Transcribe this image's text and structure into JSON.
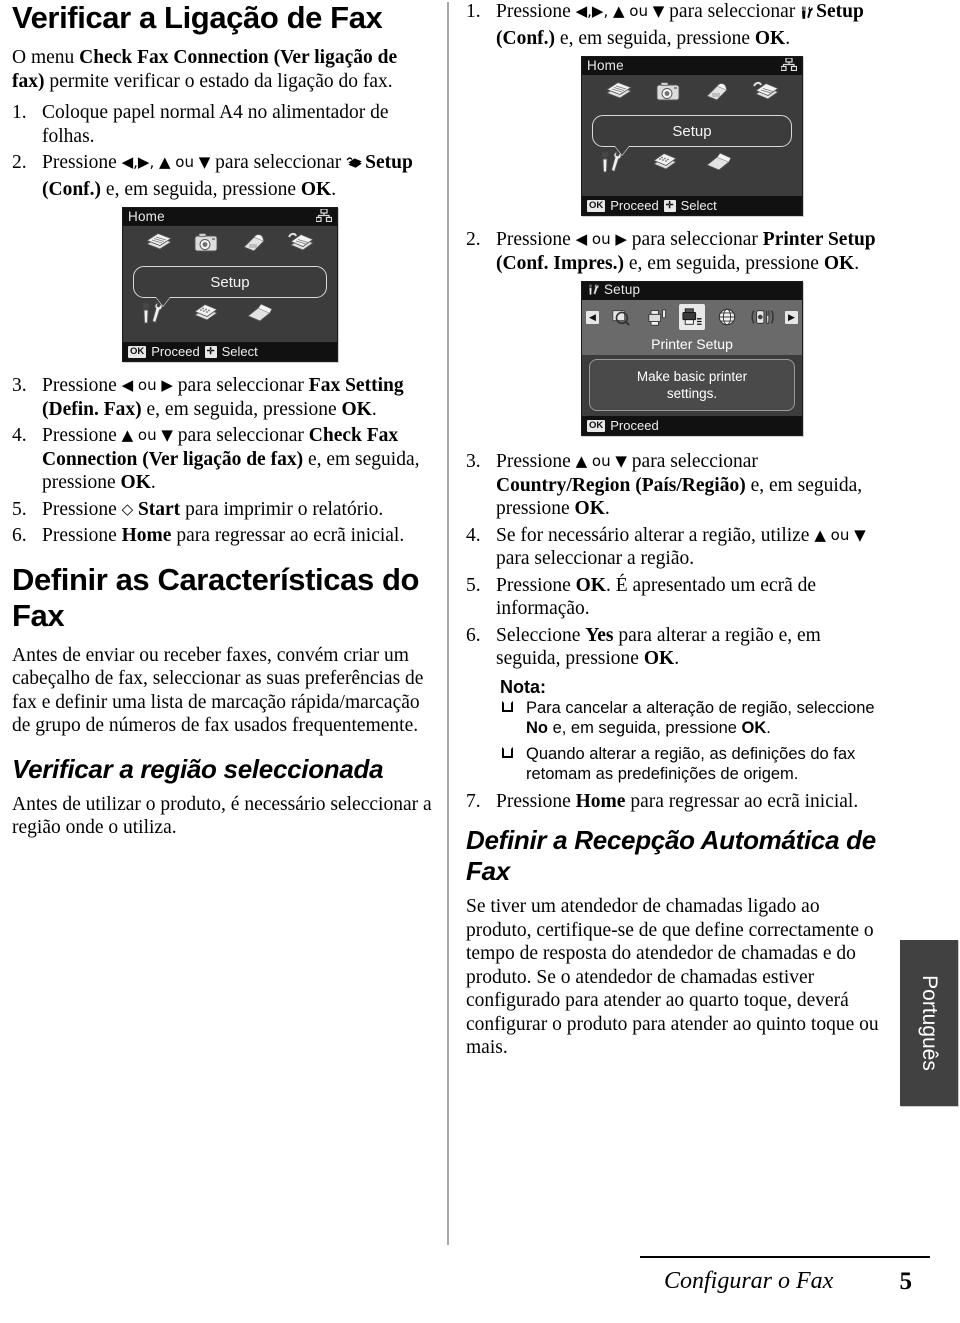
{
  "left_column": {
    "heading": "Verificar a Ligação de Fax",
    "intro_parts": {
      "a": "O menu ",
      "b": "Check Fax Connection (Ver ligação de fax)",
      "c": " permite verificar o estado da ligação do fax."
    },
    "steps": [
      {
        "num": "1.",
        "parts": [
          {
            "t": "Coloque papel normal A4 no alimentador de folhas.",
            "b": false
          }
        ]
      },
      {
        "num": "2.",
        "parts": [
          {
            "t": "Pressione ",
            "b": false
          },
          {
            "t": "◀,▶, ▲ ou ▼",
            "b": false,
            "glyph": true
          },
          {
            "t": " para seleccionar ",
            "b": false
          },
          {
            "t": "Setup (Conf.)",
            "b": true,
            "icon": "fax-icon"
          },
          {
            "t": " e, em seguida, pressione ",
            "b": false
          },
          {
            "t": "OK",
            "b": true
          },
          {
            "t": ".",
            "b": false
          }
        ]
      }
    ],
    "lcd_home": {
      "title": "Home",
      "network_icon": "network-icon",
      "top_icons": [
        "copy-icon",
        "photo-icon",
        "scan-icon",
        "fax-icon"
      ],
      "balloon_label": "Setup",
      "bottom_icons": [
        "tools-icon",
        "memorycard-icon",
        "scanner-icon"
      ],
      "footer": [
        {
          "key": "OK",
          "label": "Proceed"
        },
        {
          "key": "✛",
          "label": "Select"
        }
      ]
    },
    "steps2": [
      {
        "num": "3.",
        "parts": [
          {
            "t": "Pressione ",
            "b": false
          },
          {
            "t": "◀ ou ▶",
            "b": false,
            "glyph": true
          },
          {
            "t": " para seleccionar ",
            "b": false
          },
          {
            "t": "Fax Setting (Defin. Fax)",
            "b": true
          },
          {
            "t": " e, em seguida, pressione ",
            "b": false
          },
          {
            "t": "OK",
            "b": true
          },
          {
            "t": ".",
            "b": false
          }
        ]
      },
      {
        "num": "4.",
        "parts": [
          {
            "t": "Pressione ",
            "b": false
          },
          {
            "t": "▲ ou ▼",
            "b": false,
            "glyph": true
          },
          {
            "t": " para seleccionar ",
            "b": false
          },
          {
            "t": "Check Fax Connection (Ver ligação de fax)",
            "b": true
          },
          {
            "t": " e, em seguida, pressione ",
            "b": false
          },
          {
            "t": "OK",
            "b": true
          },
          {
            "t": ".",
            "b": false
          }
        ]
      },
      {
        "num": "5.",
        "parts": [
          {
            "t": "Pressione ",
            "b": false
          },
          {
            "t": "◇ ",
            "b": false,
            "glyph": true
          },
          {
            "t": "Start",
            "b": true
          },
          {
            "t": " para imprimir o relatório.",
            "b": false
          }
        ]
      },
      {
        "num": "6.",
        "parts": [
          {
            "t": "Pressione ",
            "b": false
          },
          {
            "t": "Home",
            "b": true
          },
          {
            "t": " para regressar ao ecrã inicial.",
            "b": false
          }
        ]
      }
    ],
    "heading2": "Definir as Características do Fax",
    "para2": "Antes de enviar ou receber faxes, convém criar um cabeçalho de fax, seleccionar as suas preferências de fax e definir uma lista de marcação rápida/marcação de grupo de números de fax usados frequentemente.",
    "heading3": "Verificar a região seleccionada",
    "para3": "Antes de utilizar o produto, é necessário seleccionar a região onde o utiliza."
  },
  "right_column": {
    "steps": [
      {
        "num": "1.",
        "parts": [
          {
            "t": "Pressione ",
            "b": false
          },
          {
            "t": "◀,▶, ▲ ou ▼",
            "b": false,
            "glyph": true
          },
          {
            "t": " para seleccionar ",
            "b": false
          },
          {
            "t": "Setup (Conf.)",
            "b": true,
            "icon": "tools-icon"
          },
          {
            "t": " e, em seguida, pressione ",
            "b": false
          },
          {
            "t": "OK",
            "b": true
          },
          {
            "t": ".",
            "b": false
          }
        ]
      }
    ],
    "lcd_home": {
      "title": "Home",
      "network_icon": "network-icon",
      "top_icons": [
        "copy-icon",
        "photo-icon",
        "scan-icon",
        "fax-icon"
      ],
      "balloon_label": "Setup",
      "bottom_icons": [
        "tools-icon",
        "memorycard-icon",
        "scanner-icon"
      ],
      "footer": [
        {
          "key": "OK",
          "label": "Proceed"
        },
        {
          "key": "✛",
          "label": "Select"
        }
      ]
    },
    "step2": {
      "num": "2.",
      "parts": [
        {
          "t": "Pressione ",
          "b": false
        },
        {
          "t": "◀ ou ▶",
          "b": false,
          "glyph": true
        },
        {
          "t": " para seleccionar ",
          "b": false
        },
        {
          "t": "Printer Setup (Conf. Impres.)",
          "b": true
        },
        {
          "t": " e, em seguida, pressione ",
          "b": false
        },
        {
          "t": "OK",
          "b": true
        },
        {
          "t": ".",
          "b": false
        }
      ]
    },
    "lcd_setup": {
      "title": "Setup",
      "title_icon": "tools-icon",
      "left_arrow": "◀",
      "right_arrow": "▶",
      "icons": [
        "ink-check-icon",
        "nozzle-check-icon",
        "printer-setup-icon",
        "network-setup-icon",
        "maintenance-icon"
      ],
      "selected_index": 2,
      "selected_name": "Printer Setup",
      "description_line1": "Make basic printer",
      "description_line2": "settings.",
      "footer": [
        {
          "key": "OK",
          "label": "Proceed"
        }
      ]
    },
    "steps2": [
      {
        "num": "3.",
        "parts": [
          {
            "t": "Pressione ",
            "b": false
          },
          {
            "t": "▲ ou ▼",
            "b": false,
            "glyph": true
          },
          {
            "t": " para seleccionar ",
            "b": false
          },
          {
            "t": "Country/Region (País/Região)",
            "b": true
          },
          {
            "t": " e, em seguida, pressione ",
            "b": false
          },
          {
            "t": "OK",
            "b": true
          },
          {
            "t": ".",
            "b": false
          }
        ]
      },
      {
        "num": "4.",
        "parts": [
          {
            "t": "Se for necessário alterar a região, utilize ",
            "b": false
          },
          {
            "t": "▲ ou ▼",
            "b": false,
            "glyph": true
          },
          {
            "t": " para seleccionar a região.",
            "b": false
          }
        ]
      },
      {
        "num": "5.",
        "parts": [
          {
            "t": "Pressione ",
            "b": false
          },
          {
            "t": "OK",
            "b": true
          },
          {
            "t": ". É apresentado um ecrã de informação.",
            "b": false
          }
        ]
      },
      {
        "num": "6.",
        "parts": [
          {
            "t": "Seleccione ",
            "b": false
          },
          {
            "t": "Yes",
            "b": true
          },
          {
            "t": " para alterar a região e, em seguida, pressione ",
            "b": false
          },
          {
            "t": "OK",
            "b": true
          },
          {
            "t": ".",
            "b": false
          }
        ]
      }
    ],
    "note": {
      "title": "Nota:",
      "items": [
        [
          {
            "t": "Para cancelar a alteração de região, seleccione ",
            "b": false
          },
          {
            "t": "No",
            "b": true
          },
          {
            "t": " e, em seguida, pressione ",
            "b": false
          },
          {
            "t": "OK",
            "b": true
          },
          {
            "t": ".",
            "b": false
          }
        ],
        [
          {
            "t": "Quando alterar a região, as definições do fax retomam as predefinições de origem.",
            "b": false
          }
        ]
      ]
    },
    "step7": {
      "num": "7.",
      "parts": [
        {
          "t": "Pressione ",
          "b": false
        },
        {
          "t": "Home",
          "b": true
        },
        {
          "t": " para regressar ao ecrã inicial.",
          "b": false
        }
      ]
    },
    "heading2": "Definir a Recepção Automática de Fax",
    "para2": "Se tiver um atendedor de chamadas ligado ao produto, certifique-se de que define correctamente o tempo de resposta do atendedor de chamadas e do produto. Se o atendedor de chamadas estiver configurado para atender ao quarto toque, deverá configurar o produto para atender ao quinto toque ou mais."
  },
  "side_tab": {
    "label": "Português"
  },
  "footer": {
    "title": "Configurar o Fax",
    "page_number": "5"
  }
}
